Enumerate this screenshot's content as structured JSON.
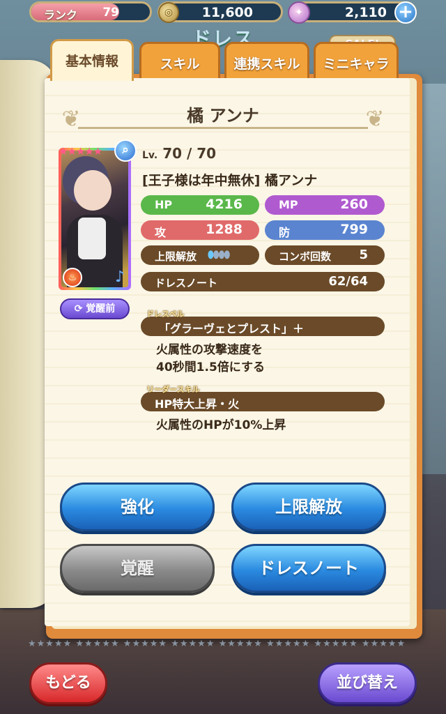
{
  "topbar": {
    "rank_label": "ランク",
    "rank_value": "79",
    "rank_progress": 0.74,
    "coins": "11,600",
    "gems": "2,110",
    "plus": "+"
  },
  "header": {
    "title": "ドレス",
    "sale": "SALE!"
  },
  "tabs": [
    {
      "label": "基本情報",
      "active": true
    },
    {
      "label": "スキル",
      "active": false
    },
    {
      "label": "連携スキル",
      "active": false
    },
    {
      "label": "ミニキャラ",
      "active": false
    }
  ],
  "character": {
    "name": "橘 アンナ",
    "stars": "★★★★★",
    "level_prefix": "Lv.",
    "level": "70 / 70",
    "title": "[王子様は年中無休] 橘アンナ",
    "awaken_state": "覚醒前"
  },
  "stats": {
    "hp_label": "HP",
    "hp": "4216",
    "mp_label": "MP",
    "mp": "260",
    "atk_label": "攻",
    "atk": "1288",
    "def_label": "防",
    "def": "799",
    "limit_label": "上限解放",
    "limit_level": 1,
    "limit_max": 4,
    "combo_label": "コンボ回数",
    "combo": "5",
    "note_label": "ドレスノート",
    "note": "62/64"
  },
  "spell": {
    "tag": "ドレスペル",
    "name": "「グラーヴェとプレスト」＋",
    "desc_line1": "火属性の攻撃速度を",
    "desc_line2": "40秒間1.5倍にする"
  },
  "leader": {
    "tag": "リーダースキル",
    "name": "HP特大上昇・火",
    "desc": "火属性のHPが10%上昇"
  },
  "actions": {
    "enhance": "強化",
    "limit_break": "上限解放",
    "awaken": "覚醒",
    "dress_note": "ドレスノート"
  },
  "bottom": {
    "back": "もどる",
    "sort": "並び替え"
  },
  "colors": {
    "hp": "#5ab84a",
    "mp": "#b05ad0",
    "atk": "#e06a6a",
    "def": "#5a84d0",
    "brown": "#6a4a28"
  }
}
